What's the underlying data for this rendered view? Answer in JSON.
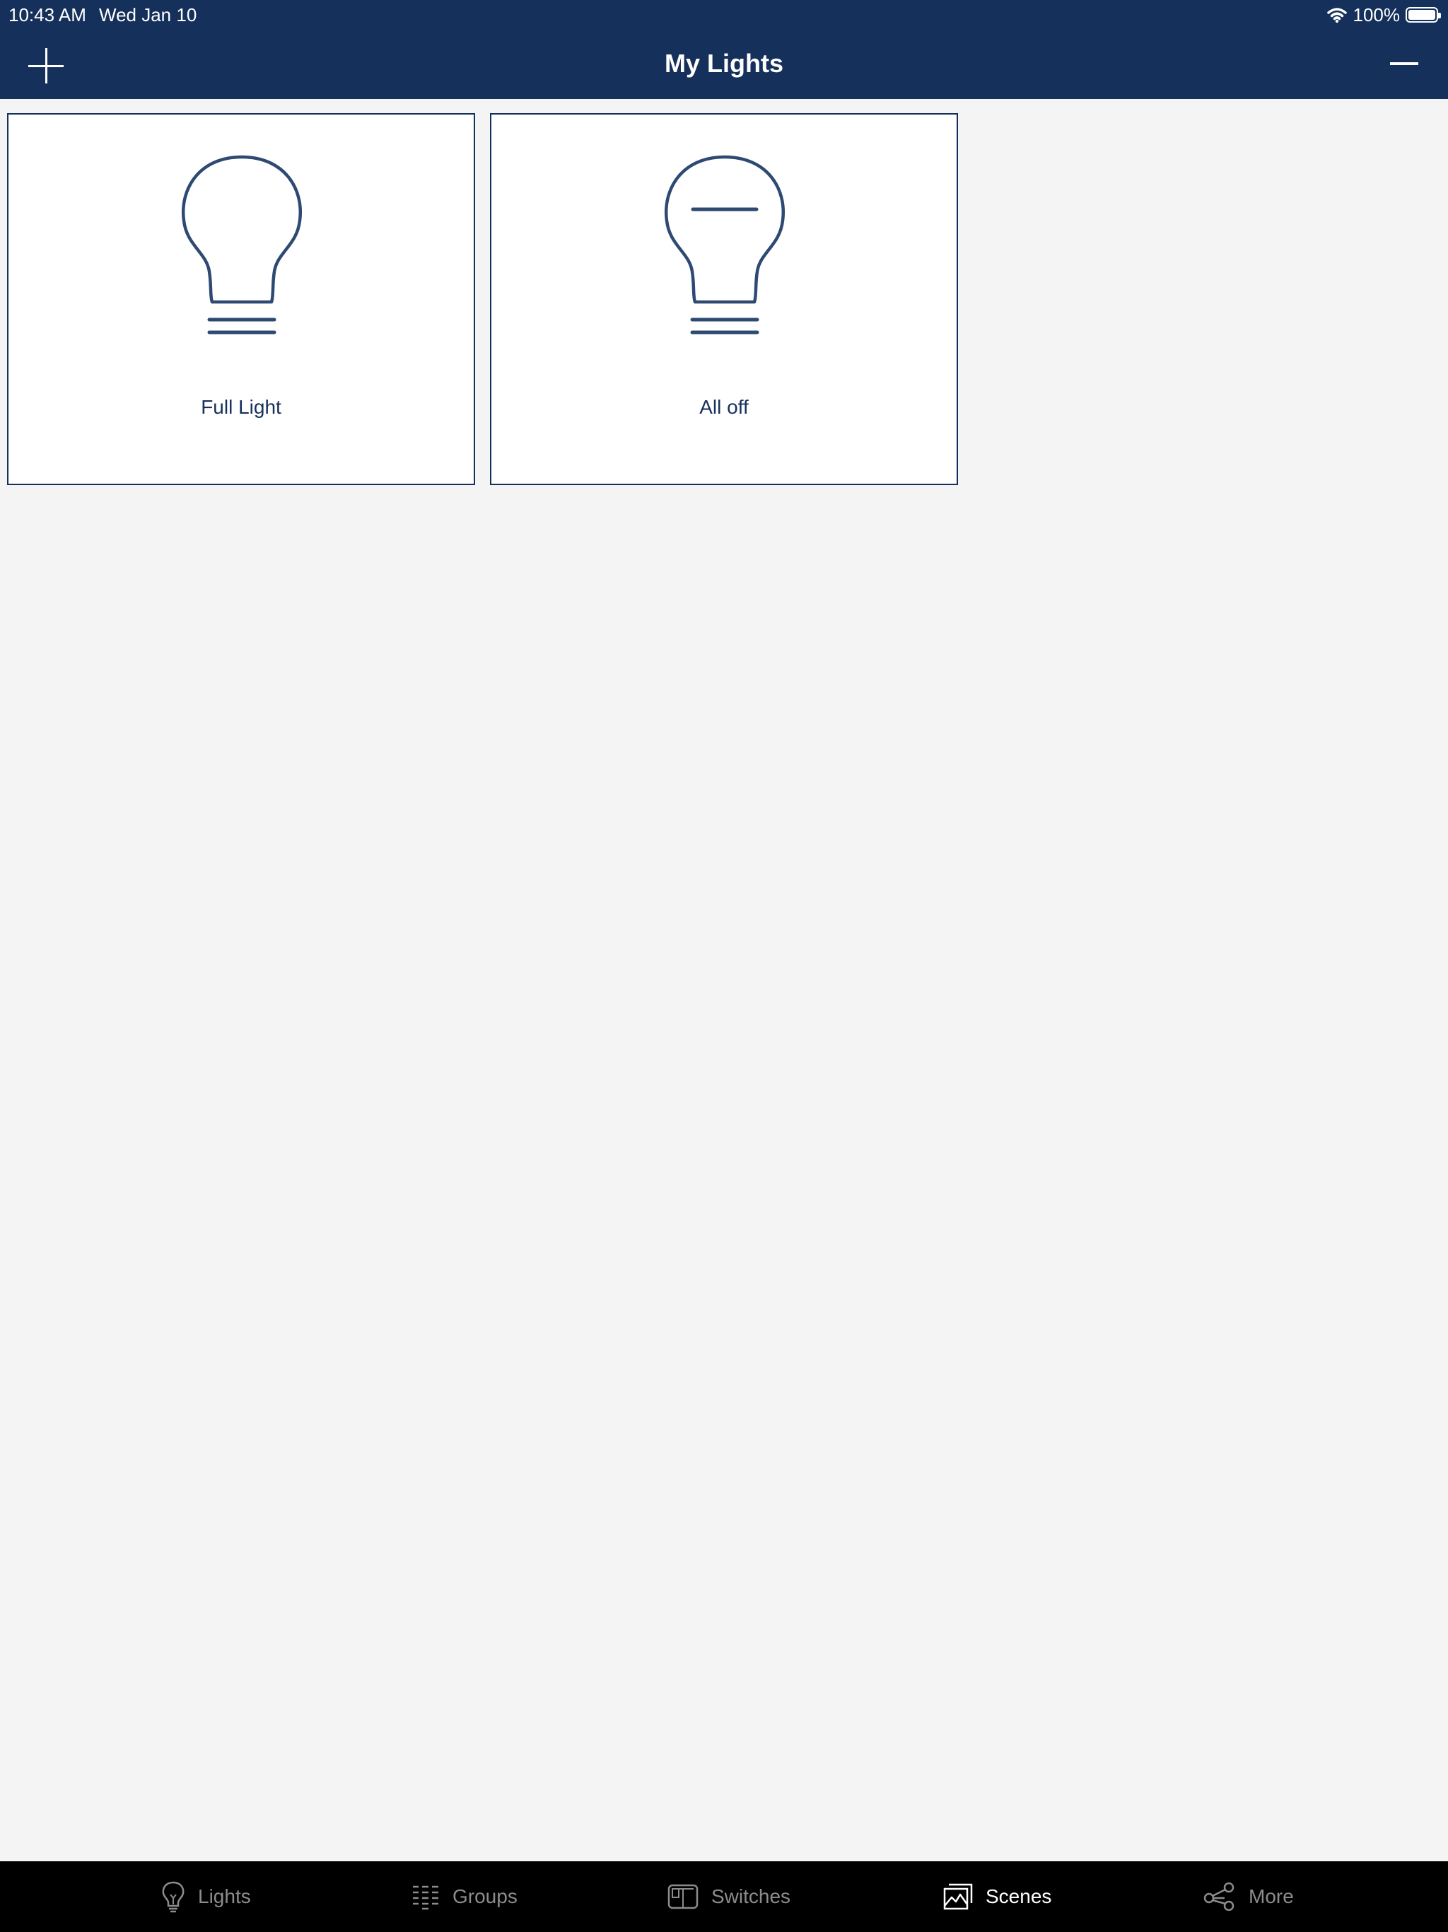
{
  "status_bar": {
    "time": "10:43 AM",
    "date": "Wed Jan 10",
    "battery_text": "100%",
    "battery_level": 1.0
  },
  "nav": {
    "title": "My Lights",
    "add_icon": "plus-icon",
    "remove_icon": "minus-icon"
  },
  "scenes": [
    {
      "label": "Full Light",
      "icon": "lightbulb-icon"
    },
    {
      "label": "All off",
      "icon": "lightbulb-off-icon"
    }
  ],
  "tabs": [
    {
      "label": "Lights",
      "icon": "lightbulb-icon",
      "active": false
    },
    {
      "label": "Groups",
      "icon": "groups-icon",
      "active": false
    },
    {
      "label": "Switches",
      "icon": "switches-icon",
      "active": false
    },
    {
      "label": "Scenes",
      "icon": "scenes-icon",
      "active": true
    },
    {
      "label": "More",
      "icon": "share-icon",
      "active": false
    }
  ],
  "colors": {
    "primary": "#15305a",
    "background": "#f4f4f4",
    "tabbar": "#000000",
    "tab_inactive": "#8c8c8c",
    "tab_active": "#ffffff"
  }
}
